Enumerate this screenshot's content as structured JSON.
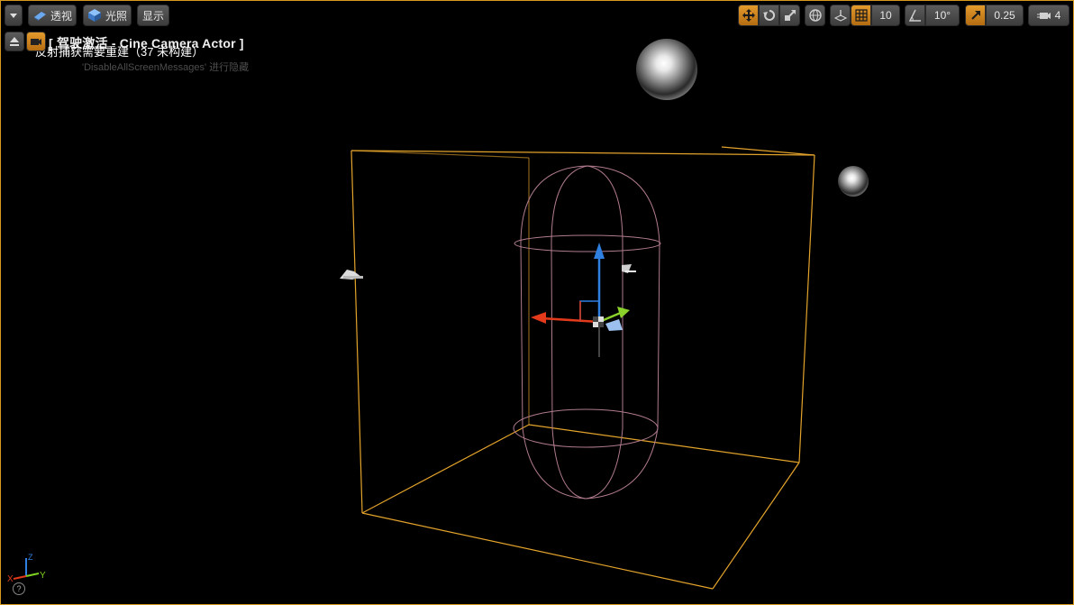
{
  "toolbar": {
    "dropdown_icon": "chevron-down-icon",
    "perspective_label": "透视",
    "lighting_label": "光照",
    "show_label": "显示",
    "grid_snap_value": "10",
    "rotation_snap_value": "10°",
    "scale_snap_value": "0.25",
    "camera_speed_value": "4"
  },
  "overlay": {
    "title": "[ 驾驶激活 - Cine Camera Actor ]",
    "message": "反射捕获需要重建（37 未构建）",
    "hint": "'DisableAllScreenMessages' 进行隐藏"
  },
  "axis_widget": {
    "x": "X",
    "y": "Y",
    "z": "Z"
  },
  "colors": {
    "accent": "#d79a1e",
    "selection_box": "#e3a32b",
    "capsule": "#b07b8f",
    "gizmo_x": "#e23a1b",
    "gizmo_y": "#8bd12c",
    "gizmo_z": "#2f7fe0"
  }
}
